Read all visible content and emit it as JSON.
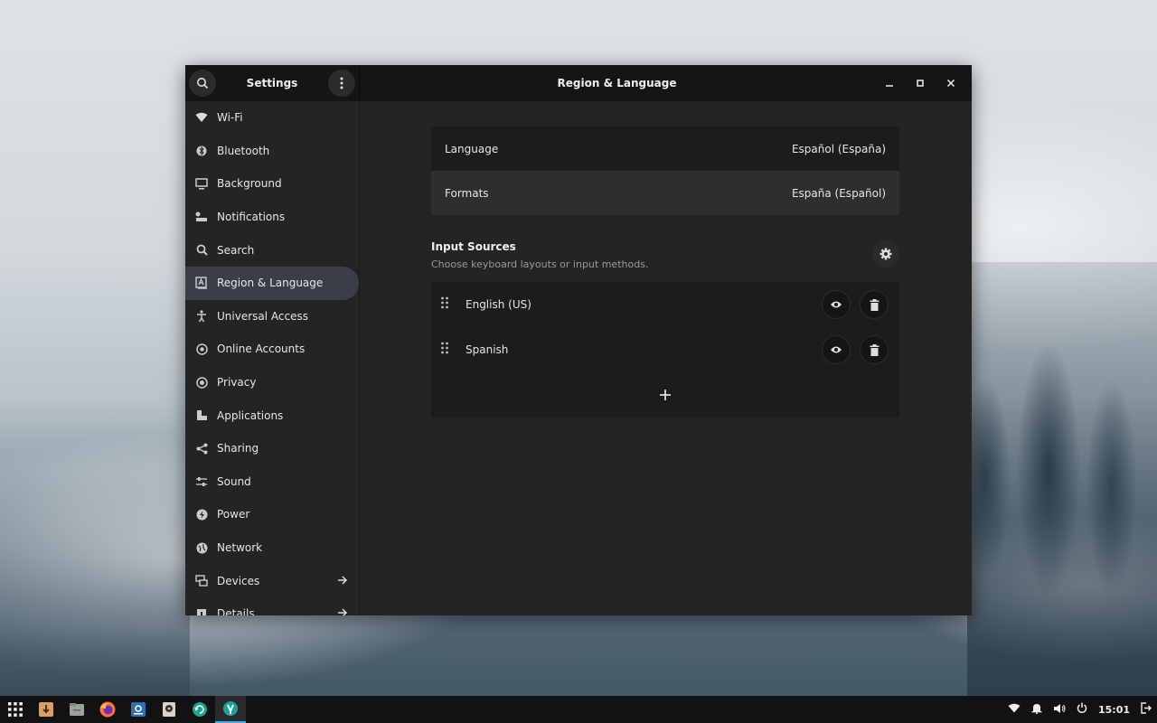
{
  "window": {
    "sidebar_title": "Settings",
    "title": "Region & Language"
  },
  "sidebar": {
    "items": [
      {
        "label": "Wi-Fi",
        "icon": "wifi-icon"
      },
      {
        "label": "Bluetooth",
        "icon": "bluetooth-icon"
      },
      {
        "label": "Background",
        "icon": "display-icon"
      },
      {
        "label": "Notifications",
        "icon": "notifications-icon"
      },
      {
        "label": "Search",
        "icon": "search-icon"
      },
      {
        "label": "Region & Language",
        "icon": "region-icon",
        "active": true
      },
      {
        "label": "Universal Access",
        "icon": "accessibility-icon"
      },
      {
        "label": "Online Accounts",
        "icon": "online-accounts-icon"
      },
      {
        "label": "Privacy",
        "icon": "privacy-icon"
      },
      {
        "label": "Applications",
        "icon": "applications-icon"
      },
      {
        "label": "Sharing",
        "icon": "sharing-icon"
      },
      {
        "label": "Sound",
        "icon": "sound-icon"
      },
      {
        "label": "Power",
        "icon": "power-icon"
      },
      {
        "label": "Network",
        "icon": "network-icon"
      },
      {
        "label": "Devices",
        "icon": "devices-icon",
        "arrow": true
      },
      {
        "label": "Details",
        "icon": "details-icon",
        "arrow": true
      }
    ]
  },
  "region": {
    "language_label": "Language",
    "language_value": "Español (España)",
    "formats_label": "Formats",
    "formats_value": "España (Español)"
  },
  "input_sources": {
    "title": "Input Sources",
    "subtitle": "Choose keyboard layouts or input methods.",
    "sources": [
      {
        "label": "English (US)"
      },
      {
        "label": "Spanish"
      }
    ]
  },
  "taskbar": {
    "clock": "15:01",
    "apps": [
      "app-grid-icon",
      "downloader-icon",
      "files-icon",
      "firefox-icon",
      "software-icon",
      "disk-icon",
      "update-icon",
      "settings-icon"
    ]
  },
  "colors": {
    "accent": "#3daee9",
    "active_row": "#3a3f47"
  }
}
